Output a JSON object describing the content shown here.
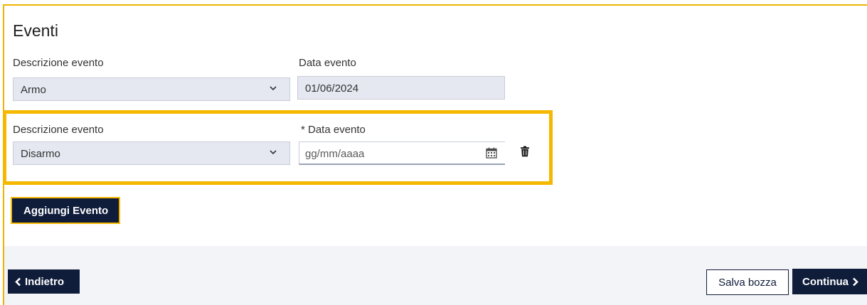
{
  "section": {
    "title": "Eventi"
  },
  "events": [
    {
      "description_label": "Descrizione evento",
      "description_value": "Armo",
      "date_label": "Data evento",
      "date_value": "01/06/2024"
    },
    {
      "description_label": "Descrizione evento",
      "description_value": "Disarmo",
      "date_label": "* Data evento",
      "date_placeholder": "gg/mm/aaaa"
    }
  ],
  "buttons": {
    "add_event": "Aggiungi Evento",
    "back": "Indietro",
    "save_draft": "Salva bozza",
    "continue": "Continua"
  },
  "icons": [
    "chevron-down-icon",
    "calendar-icon",
    "trash-icon",
    "chevron-left-icon",
    "chevron-right-icon"
  ],
  "colors": {
    "accent": "#f5b800",
    "primary_button": "#0f1c3a",
    "field_background": "#e5e8f0",
    "footer_background": "#f2f4f7"
  }
}
